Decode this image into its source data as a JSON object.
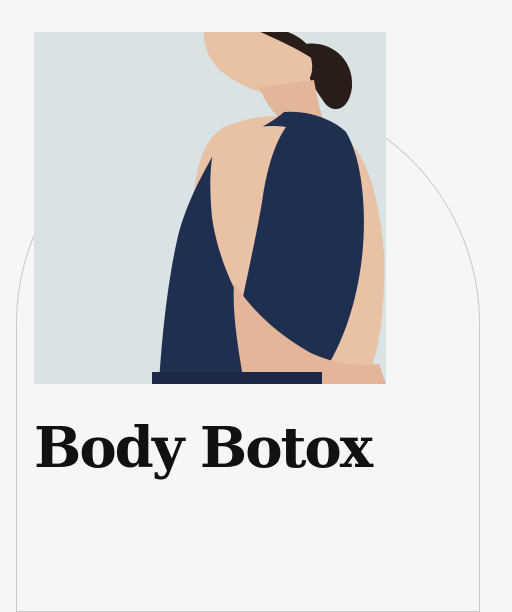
{
  "card": {
    "title": "Body Botox",
    "image": {
      "subject": "model-back-in-navy-tank-top",
      "background_color": "#d9e2e5",
      "garment_color": "#1f2f4f",
      "skin_color": "#e9c2a6",
      "hair_color": "#2a1d17"
    },
    "frame_color": "#c9c9c9",
    "page_background": "#f6f6f6",
    "title_color": "#111111"
  }
}
